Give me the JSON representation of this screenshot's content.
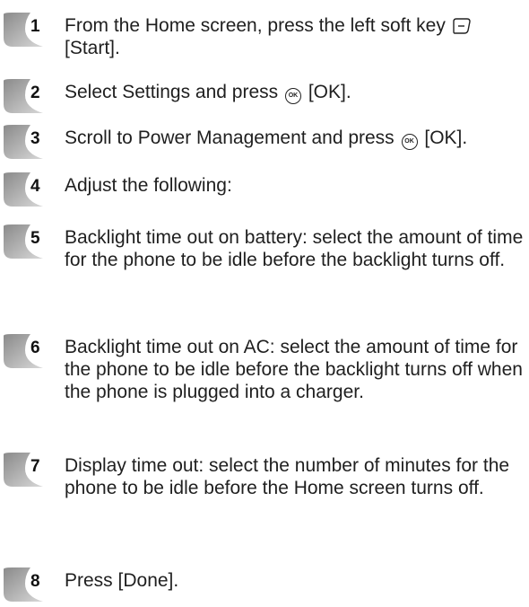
{
  "steps": [
    {
      "number": "1",
      "before": "From the Home screen, press the left soft key ",
      "after": " [Start].",
      "icon": "left-soft-key-icon"
    },
    {
      "number": "2",
      "before": "Select Settings and press ",
      "after": " [OK].",
      "icon": "ok-key-icon",
      "icon_text": "OK"
    },
    {
      "number": "3",
      "before": "Scroll to Power Management and press ",
      "after": " [OK].",
      "icon": "ok-key-icon",
      "icon_text": "OK"
    },
    {
      "number": "4",
      "text": "Adjust the following:"
    },
    {
      "number": "5",
      "text": "Backlight time out on battery: select the amount of time for the phone to be idle before the backlight turns off."
    },
    {
      "number": "6",
      "text": "Backlight time out on AC: select the amount of time for the phone to be idle before the backlight turns off when the phone is plugged into a charger."
    },
    {
      "number": "7",
      "text": "Display time out: select the number of minutes for the phone to be idle before the Home screen turns off."
    },
    {
      "number": "8",
      "text": "Press [Done]."
    }
  ],
  "colors": {
    "badge_dark": "#8a8a8a",
    "badge_light": "#d9d9d9"
  }
}
